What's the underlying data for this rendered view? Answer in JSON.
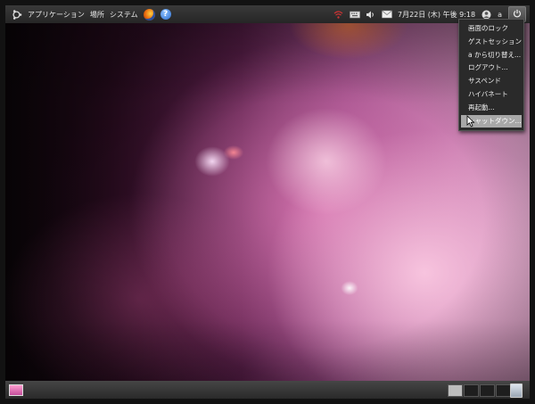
{
  "top_panel": {
    "menus": [
      "アプリケーション",
      "場所",
      "システム"
    ],
    "clock": "7月22日 (木) 午後 9:18",
    "user": "a"
  },
  "session_menu": {
    "items": [
      "画面のロック",
      "ゲストセッション",
      "a から切り替え...",
      "ログアウト...",
      "サスペンド",
      "ハイバネート",
      "再起動...",
      "シャットダウン..."
    ],
    "active_index": 7
  },
  "bottom_panel": {
    "workspace_count": 4,
    "active_workspace": 1
  }
}
